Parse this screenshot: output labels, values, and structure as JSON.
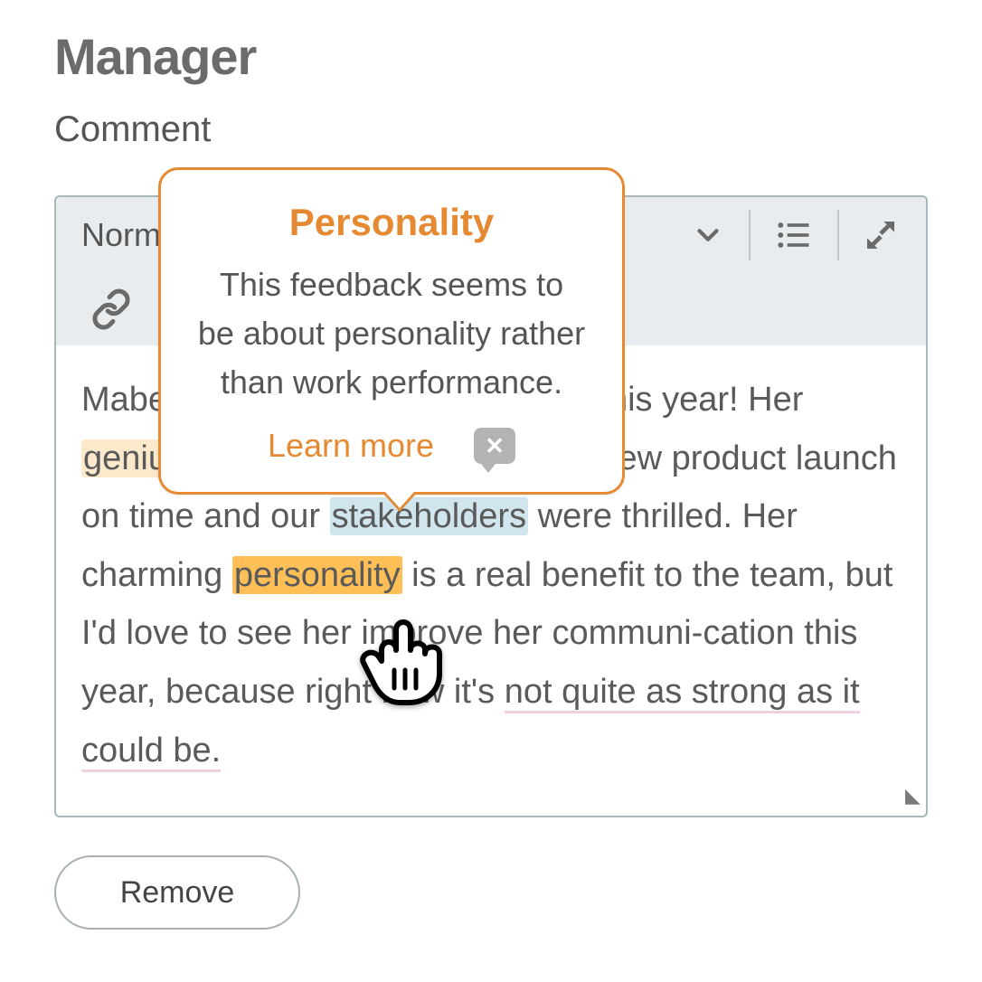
{
  "accent": "#e58a32",
  "header": {
    "title": "Manager",
    "label": "Comment"
  },
  "toolbar": {
    "style_select": "Normal",
    "icons": [
      "chevron-down",
      "bullet-list",
      "expand",
      "link"
    ]
  },
  "content": {
    "t1": "Mabel has done some great work this year! Her ",
    "t2": "genius",
    "t3": " ideas helped us to get the new product launch on time and our ",
    "t4": "stakeholders",
    "t5": " were thrilled. Her charming ",
    "t6": "personality",
    "t7": " is a real benefit to the team, but I'd love to see her improve her communi-cation this year, because right now it's ",
    "t8": "not quite as strong as it could be."
  },
  "popover": {
    "title": "Personality",
    "body": "This feedback seems to be about personality rather than work performance.",
    "link": "Learn more"
  },
  "buttons": {
    "remove": "Remove"
  }
}
